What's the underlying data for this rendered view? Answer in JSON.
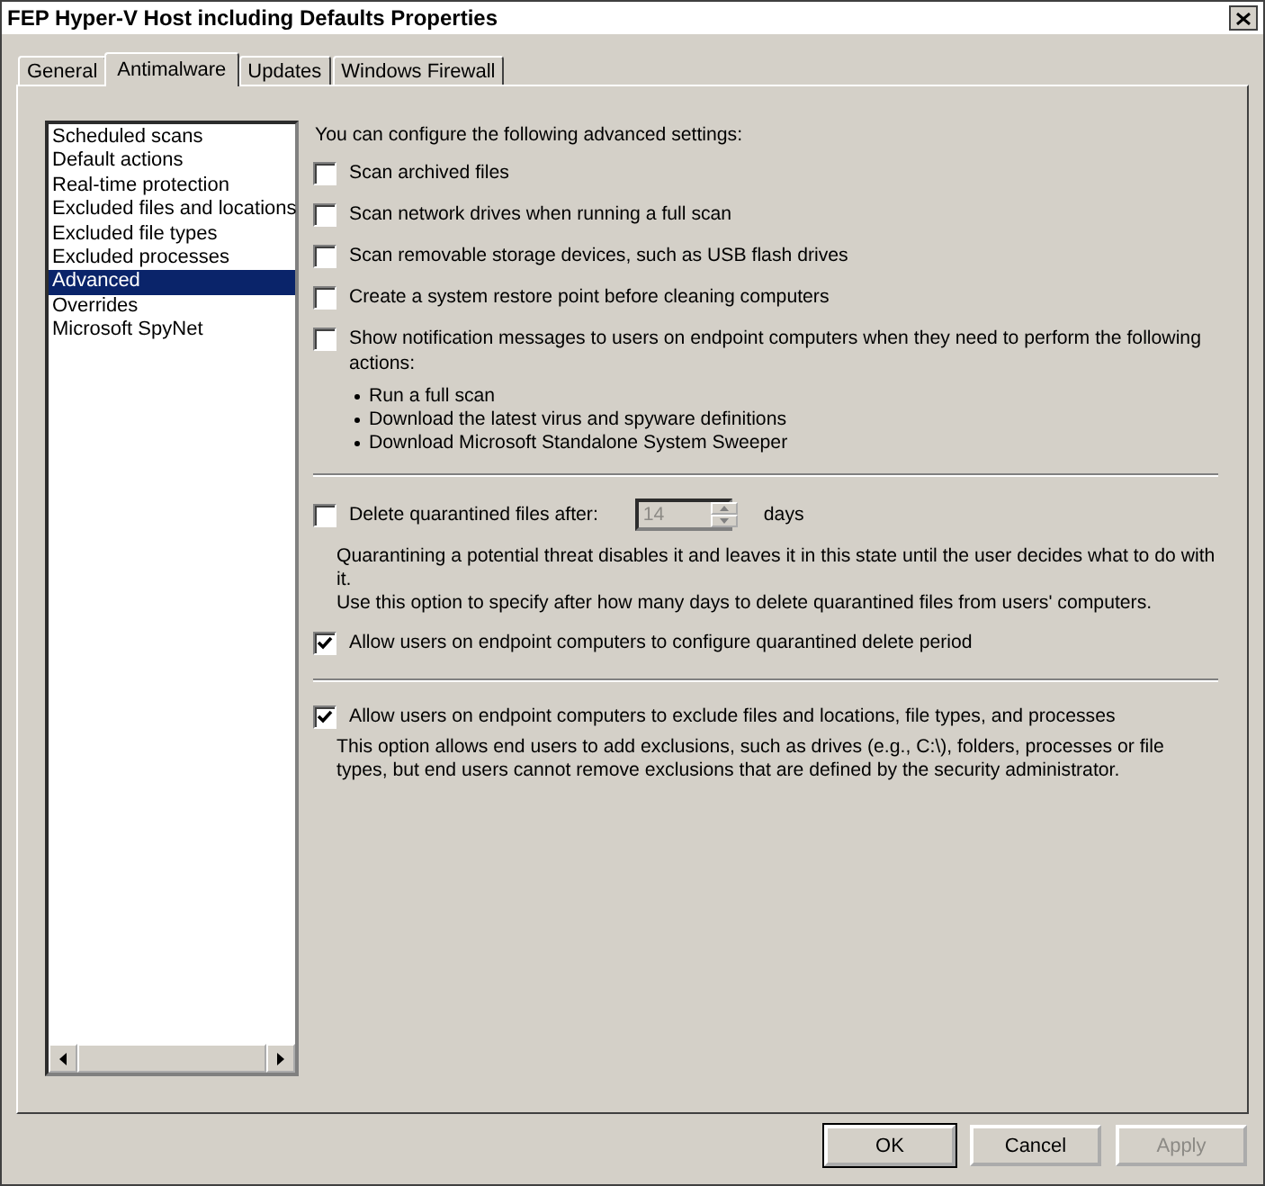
{
  "window": {
    "title": "FEP Hyper-V Host including Defaults Properties"
  },
  "tabs": [
    {
      "label": "General",
      "selected": false
    },
    {
      "label": "Antimalware",
      "selected": true
    },
    {
      "label": "Updates",
      "selected": false
    },
    {
      "label": "Windows Firewall",
      "selected": false
    }
  ],
  "sidebar": {
    "items": [
      {
        "label": "Scheduled scans",
        "selected": false
      },
      {
        "label": "Default actions",
        "selected": false
      },
      {
        "label": "Real-time protection",
        "selected": false
      },
      {
        "label": "Excluded files and locations",
        "selected": false
      },
      {
        "label": "Excluded file types",
        "selected": false
      },
      {
        "label": "Excluded processes",
        "selected": false
      },
      {
        "label": "Advanced",
        "selected": true
      },
      {
        "label": "Overrides",
        "selected": false
      },
      {
        "label": "Microsoft SpyNet",
        "selected": false
      }
    ]
  },
  "advanced": {
    "intro": "You can configure the following advanced settings:",
    "options": [
      {
        "label": "Scan archived files",
        "checked": false
      },
      {
        "label": "Scan network drives when running a full scan",
        "checked": false
      },
      {
        "label": "Scan removable storage devices, such as USB flash drives",
        "checked": false
      },
      {
        "label": "Create a system restore point before cleaning computers",
        "checked": false
      },
      {
        "label": "Show notification messages to users on endpoint computers when they need to perform the following actions:",
        "checked": false,
        "actions": [
          "Run a full scan",
          "Download the latest virus and spyware definitions",
          "Download Microsoft Standalone System Sweeper"
        ]
      }
    ]
  },
  "quarantine": {
    "label": "Delete quarantined files after:",
    "checked": false,
    "spinner": {
      "value": "14",
      "disabled": true
    },
    "unit": "days",
    "description": [
      "Quarantining a potential threat disables it and leaves it in this state until the user decides what to do with it.",
      "Use this option to specify after how many days to delete quarantined files from users' computers."
    ],
    "option": {
      "label": "Allow users on endpoint computers to configure quarantined delete period",
      "checked": true
    }
  },
  "exclusions": {
    "label": "Allow users on endpoint computers to exclude files and locations, file types, and processes",
    "checked": true,
    "description": "This option allows end users to add exclusions, such as drives (e.g., C:\\), folders, processes or file types, but end users cannot remove exclusions that are defined by the security administrator."
  },
  "buttons": [
    {
      "label": "OK",
      "default": true,
      "disabled": false
    },
    {
      "label": "Cancel",
      "default": false,
      "disabled": false
    },
    {
      "label": "Apply",
      "default": false,
      "disabled": true
    }
  ]
}
